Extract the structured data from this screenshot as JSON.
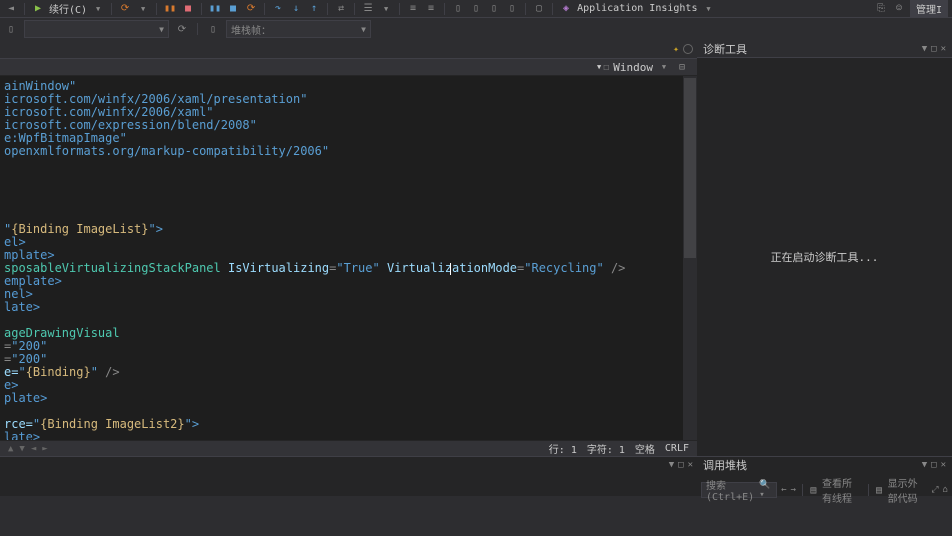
{
  "toolbar": {
    "debug_label": "续行(C)",
    "app_insights": "Application Insights",
    "right_btn": "管理I"
  },
  "toolbar2": {
    "combo2": "堆栈帧："
  },
  "doc": {
    "title": "Window"
  },
  "code": {
    "l1": "ainWindow\"",
    "l2": "icrosoft.com/winfx/2006/xaml/presentation\"",
    "l3": "icrosoft.com/winfx/2006/xaml\"",
    "l4": "icrosoft.com/expression/blend/2008\"",
    "l5": "e:WpfBitmapImage\"",
    "l6": "openxmlformats.org/markup-compatibility/2006\"",
    "l7a": "\"",
    "l7b": "{Binding ImageList}",
    "l7c": "\">",
    "l8": "el>",
    "l9": "mplate>",
    "l10a": "sposableVirtualizingStackPanel",
    "l10b": "IsVirtualizing",
    "l10c": "=",
    "l10d": "\"True\"",
    "l10e": "VirtualizationMode",
    "l10f": "=",
    "l10g": "\"Recycling\"",
    "l10h": " />",
    "l11": "emplate>",
    "l12": "nel>",
    "l13": "late>",
    "l14": "ageDrawingVisual",
    "l15a": "=",
    "l15b": "\"200\"",
    "l16a": "=",
    "l16b": "\"200\"",
    "l17a": "e=",
    "l17b": "\"",
    "l17c": "{Binding}",
    "l17d": "\"",
    "l17e": " />",
    "l18": "e>",
    "l19": "plate>",
    "l20a": "rce=",
    "l20b": "\"",
    "l20c": "{Binding ImageList2}",
    "l20d": "\">",
    "l21": "late>",
    "l22": ">"
  },
  "status": {
    "line": "行: 1",
    "col": "字符: 1",
    "space": "空格",
    "crlf": "CRLF"
  },
  "right_panel": {
    "title": "诊断工具",
    "body": "正在启动诊断工具..."
  },
  "bottom_right": {
    "title": "调用堆栈",
    "search_placeholder": "搜索(Ctrl+E)",
    "btn1": "查看所有线程",
    "btn2": "显示外部代码"
  }
}
